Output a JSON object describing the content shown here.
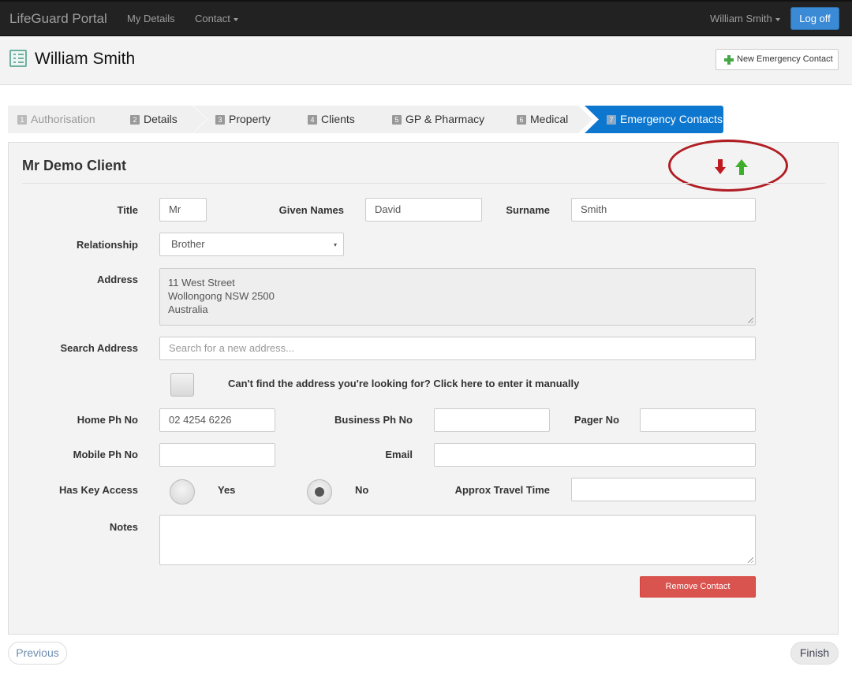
{
  "navbar": {
    "brand": "LifeGuard Portal",
    "links": [
      {
        "label": "My Details",
        "dropdown": false
      },
      {
        "label": "Contact",
        "dropdown": true
      }
    ],
    "user_menu": "William Smith",
    "logoff_label": "Log off",
    "logoff_color": "#3a8ad6"
  },
  "header": {
    "icon": "checklist-icon",
    "title": "William Smith",
    "new_contact_label": "New Emergency Contact"
  },
  "wizard": {
    "steps": [
      {
        "num": "1",
        "label": "Authorisation",
        "state": "disabled"
      },
      {
        "num": "2",
        "label": "Details",
        "state": "normal"
      },
      {
        "num": "3",
        "label": "Property",
        "state": "normal"
      },
      {
        "num": "4",
        "label": "Clients",
        "state": "normal"
      },
      {
        "num": "5",
        "label": "GP & Pharmacy",
        "state": "normal"
      },
      {
        "num": "6",
        "label": "Medical",
        "state": "normal"
      },
      {
        "num": "7",
        "label": "Emergency Contacts",
        "state": "active"
      }
    ],
    "active_color": "#0d77cf"
  },
  "contact": {
    "heading": "Mr Demo Client",
    "reorder": {
      "down_icon": "arrow-down-icon",
      "down_color": "#c0191f",
      "up_icon": "arrow-up-icon",
      "up_color": "#3fae2a"
    },
    "fields": {
      "title": {
        "label": "Title",
        "value": "Mr"
      },
      "given_names": {
        "label": "Given Names",
        "value": "David"
      },
      "surname": {
        "label": "Surname",
        "value": "Smith"
      },
      "relationship": {
        "label": "Relationship",
        "value": "Brother"
      },
      "address": {
        "label": "Address",
        "lines": [
          "11 West Street",
          "Wollongong NSW 2500",
          "Australia"
        ]
      },
      "search_address": {
        "label": "Search Address",
        "value": "",
        "placeholder": "Search for a new address..."
      },
      "manual_entry": {
        "label": "Can't find the address you're looking for? Click here to enter it manually",
        "checked": false
      },
      "home_ph": {
        "label": "Home Ph No",
        "value": "02 4254 6226"
      },
      "business_ph": {
        "label": "Business Ph No",
        "value": ""
      },
      "pager": {
        "label": "Pager No",
        "value": ""
      },
      "mobile_ph": {
        "label": "Mobile Ph No",
        "value": ""
      },
      "email": {
        "label": "Email",
        "value": ""
      },
      "key_access": {
        "label": "Has Key Access",
        "options": [
          "Yes",
          "No"
        ],
        "selected": "No"
      },
      "travel_time": {
        "label": "Approx Travel Time",
        "value": ""
      },
      "notes": {
        "label": "Notes",
        "value": ""
      }
    },
    "remove_label": "Remove Contact",
    "remove_color": "#d9534f"
  },
  "footer": {
    "previous_label": "Previous",
    "finish_label": "Finish"
  }
}
